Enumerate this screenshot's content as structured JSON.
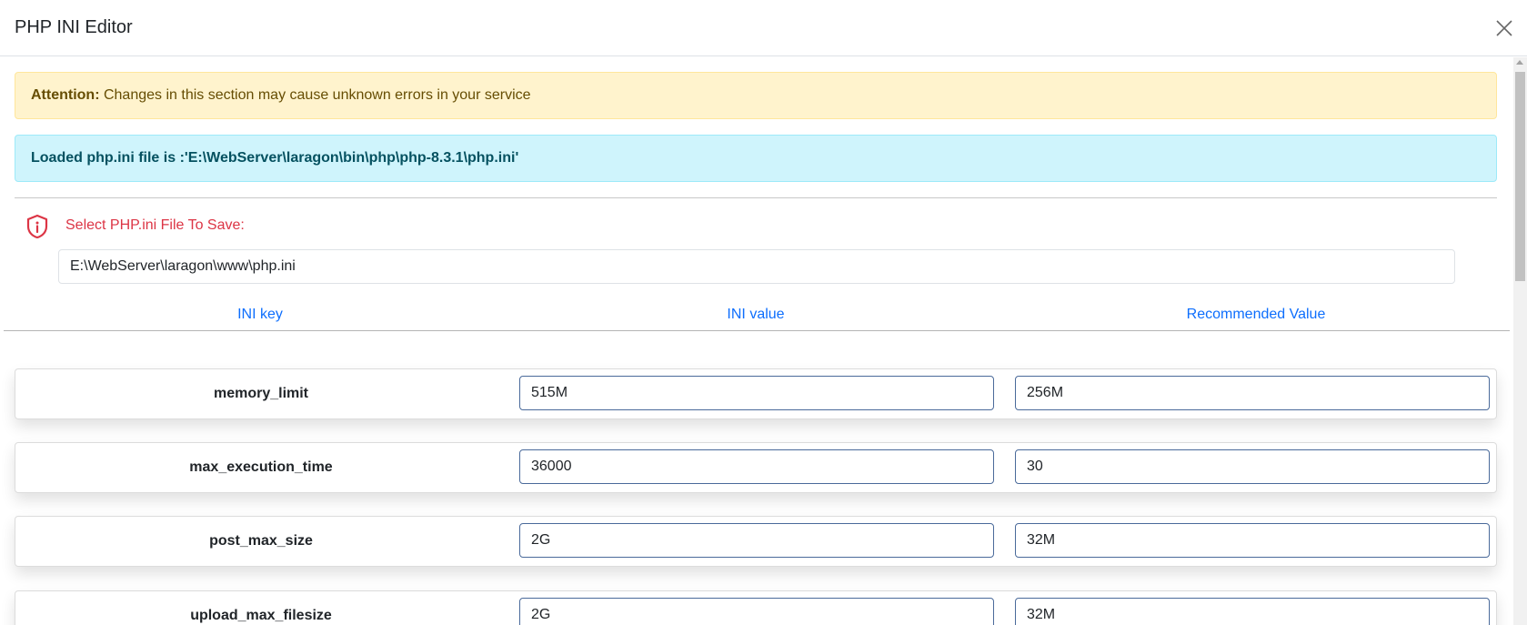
{
  "dialog": {
    "title": "PHP INI Editor",
    "close_icon": "close-icon"
  },
  "alerts": {
    "warning_strong": "Attention:",
    "warning_text": " Changes in this section may cause unknown errors in your service",
    "info_text": "Loaded php.ini file is :'E:\\WebServer\\laragon\\bin\\php\\php-8.3.1\\php.ini'"
  },
  "save_section": {
    "icon": "shield-info-icon",
    "label": "Select PHP.ini File To Save:",
    "file_path": "E:\\WebServer\\laragon\\www\\php.ini"
  },
  "table": {
    "headers": [
      "INI key",
      "INI value",
      "Recommended Value"
    ],
    "rows": [
      {
        "key": "memory_limit",
        "value": "515M",
        "recommended": "256M"
      },
      {
        "key": "max_execution_time",
        "value": "36000",
        "recommended": "30"
      },
      {
        "key": "post_max_size",
        "value": "2G",
        "recommended": "32M"
      },
      {
        "key": "upload_max_filesize",
        "value": "2G",
        "recommended": "32M"
      }
    ]
  },
  "colors": {
    "accent": "#0d6efd",
    "danger": "#dc3545",
    "warning_bg": "#fff3cd",
    "info_bg": "#cff4fc"
  }
}
